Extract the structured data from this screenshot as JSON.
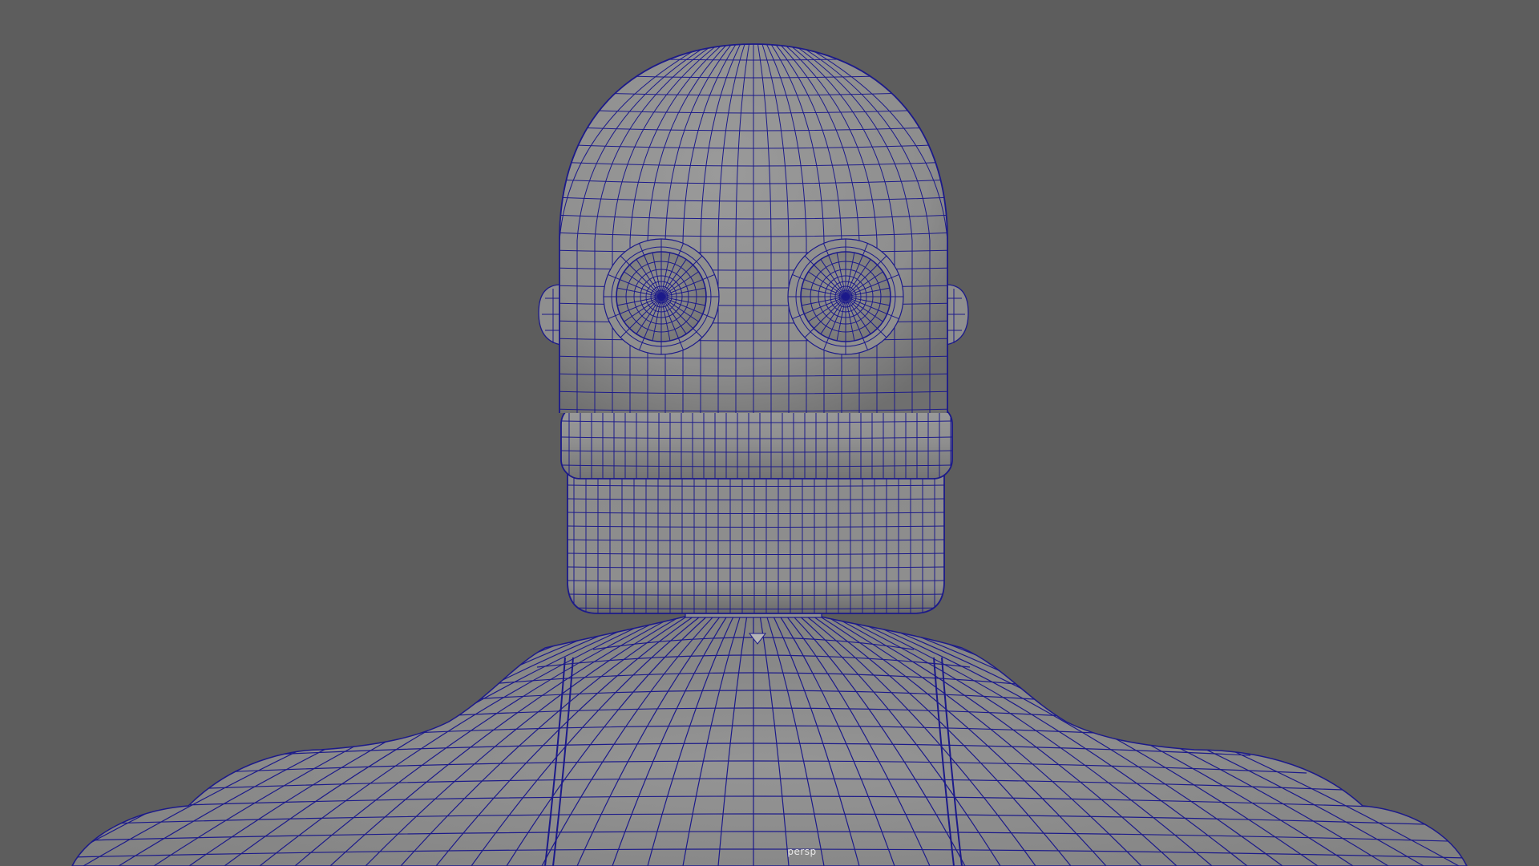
{
  "viewport": {
    "camera_name": "persp",
    "background_color": "#5d5d5d",
    "mesh_fill_color": "#8f8f8f",
    "wireframe_color": "#1c1a8a"
  },
  "model": {
    "parts": [
      "head",
      "mouth-band",
      "jaw",
      "ears",
      "eye-sockets",
      "neck",
      "torso",
      "shoulders"
    ]
  }
}
